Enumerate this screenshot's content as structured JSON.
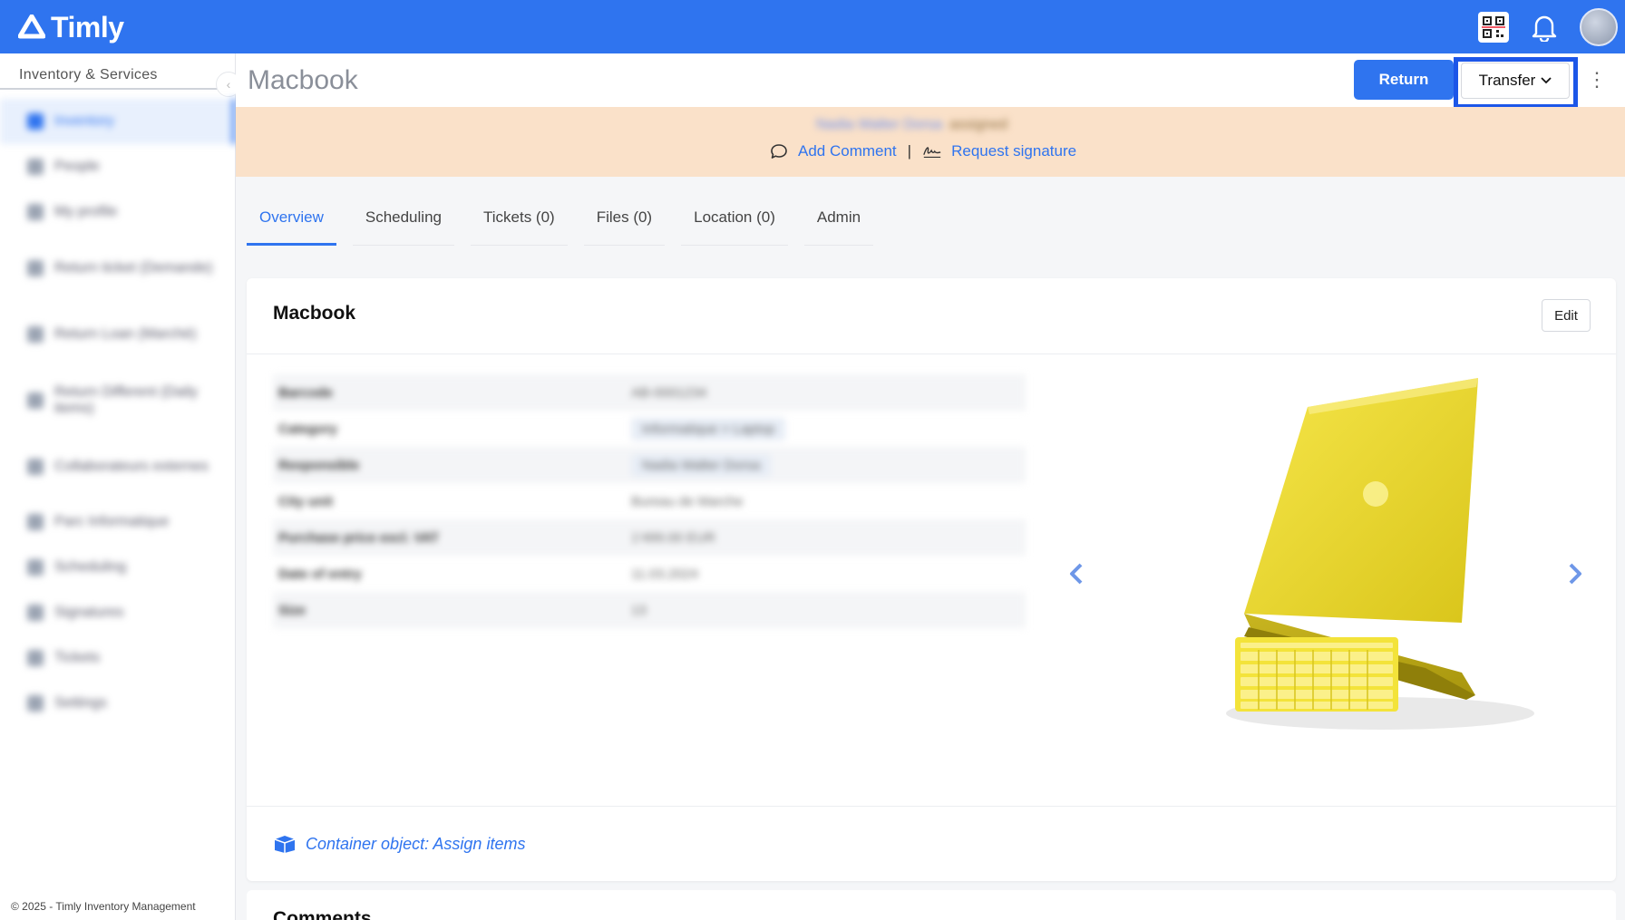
{
  "app": {
    "name": "Timly",
    "accent": "#2f74ef"
  },
  "sidebar": {
    "section_title": "Inventory & Services",
    "items": [
      {
        "label": "Inventory",
        "active": true
      },
      {
        "label": "People"
      },
      {
        "label": "My profile"
      },
      {
        "label": "Return ticket (Demande)"
      },
      {
        "label": "Return Loan (Marché)"
      },
      {
        "label": "Return Different (Daily items)"
      },
      {
        "label": "Collaborateurs externes"
      },
      {
        "label": "Parc Informatique"
      },
      {
        "label": "Scheduling"
      },
      {
        "label": "Signatures"
      },
      {
        "label": "Tickets"
      },
      {
        "label": "Settings"
      }
    ],
    "footer": "© 2025 - Timly Inventory Management"
  },
  "header": {
    "title": "Macbook",
    "return_label": "Return",
    "transfer_label": "Transfer",
    "kebab": "⋮"
  },
  "banner": {
    "assignee_name": "Nadia Walter Dorsa",
    "assignee_suffix": "assigned",
    "add_comment": "Add Comment",
    "separator": "|",
    "request_signature": "Request signature"
  },
  "tabs": [
    {
      "label": "Overview",
      "active": true
    },
    {
      "label": "Scheduling"
    },
    {
      "label": "Tickets (0)"
    },
    {
      "label": "Files (0)"
    },
    {
      "label": "Location (0)"
    },
    {
      "label": "Admin"
    }
  ],
  "card": {
    "title": "Macbook",
    "edit_label": "Edit",
    "details": [
      {
        "label": "Barcode",
        "value": "AB-0001234"
      },
      {
        "label": "Category",
        "value": "Informatique > Laptop",
        "chip": true
      },
      {
        "label": "Responsible",
        "value": "Nadia Walter Dorsa",
        "chip": true
      },
      {
        "label": "City unit",
        "value": "Bureau de Marche"
      },
      {
        "label": "Purchase price excl. VAT",
        "value": "1'499.00 EUR"
      },
      {
        "label": "Date of entry",
        "value": "11.03.2024"
      },
      {
        "label": "Size",
        "value": "13"
      }
    ],
    "container_link": "Container object: Assign items"
  },
  "card2": {
    "title": "Comments"
  }
}
